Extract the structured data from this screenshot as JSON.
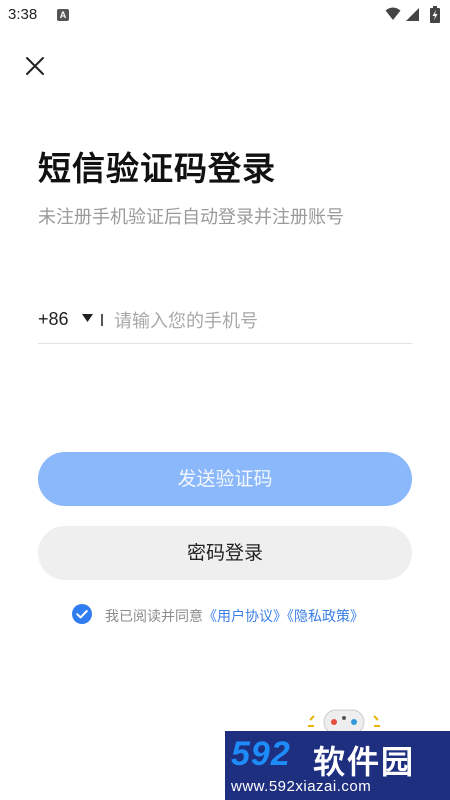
{
  "status_bar": {
    "time": "3:38",
    "app_badge": "A"
  },
  "header": {
    "close_icon": "close-icon"
  },
  "login": {
    "title": "短信验证码登录",
    "subtitle": "未注册手机验证后自动登录并注册账号",
    "country_code": "+86",
    "phone_placeholder": "请输入您的手机号",
    "phone_value": "",
    "send_code_label": "发送验证码",
    "password_login_label": "密码登录"
  },
  "agreement": {
    "checked": true,
    "prefix": "我已阅读并同意",
    "user_agreement": "《用户协议》",
    "privacy_policy": "《隐私政策》"
  },
  "colors": {
    "primary_disabled": "#8ab8fa",
    "link": "#3a7fe6",
    "check": "#2f7df0"
  },
  "watermark": {
    "logo": "592",
    "name": "软件园",
    "url": "www.592xiazai.com"
  }
}
